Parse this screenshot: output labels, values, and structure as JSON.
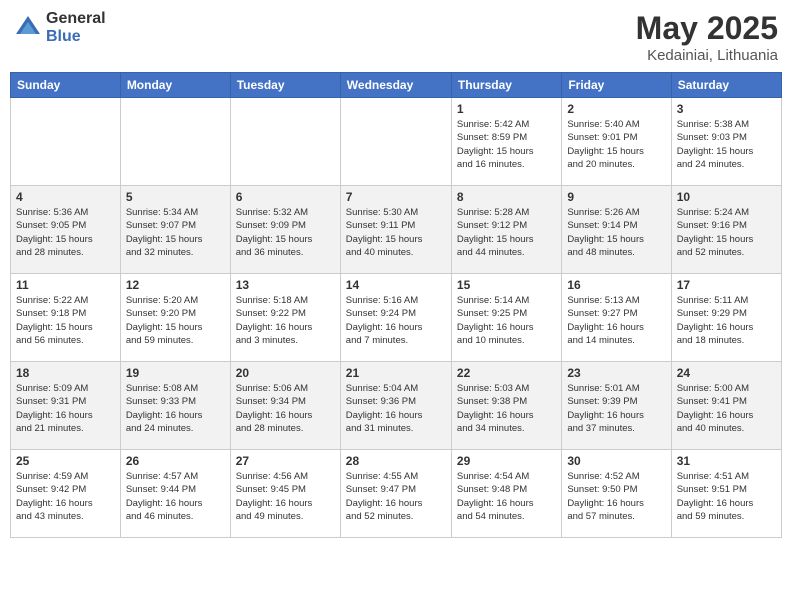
{
  "header": {
    "logo_general": "General",
    "logo_blue": "Blue",
    "month_year": "May 2025",
    "location": "Kedainiai, Lithuania"
  },
  "weekdays": [
    "Sunday",
    "Monday",
    "Tuesday",
    "Wednesday",
    "Thursday",
    "Friday",
    "Saturday"
  ],
  "weeks": [
    [
      {
        "day": "",
        "info": ""
      },
      {
        "day": "",
        "info": ""
      },
      {
        "day": "",
        "info": ""
      },
      {
        "day": "",
        "info": ""
      },
      {
        "day": "1",
        "info": "Sunrise: 5:42 AM\nSunset: 8:59 PM\nDaylight: 15 hours\nand 16 minutes."
      },
      {
        "day": "2",
        "info": "Sunrise: 5:40 AM\nSunset: 9:01 PM\nDaylight: 15 hours\nand 20 minutes."
      },
      {
        "day": "3",
        "info": "Sunrise: 5:38 AM\nSunset: 9:03 PM\nDaylight: 15 hours\nand 24 minutes."
      }
    ],
    [
      {
        "day": "4",
        "info": "Sunrise: 5:36 AM\nSunset: 9:05 PM\nDaylight: 15 hours\nand 28 minutes."
      },
      {
        "day": "5",
        "info": "Sunrise: 5:34 AM\nSunset: 9:07 PM\nDaylight: 15 hours\nand 32 minutes."
      },
      {
        "day": "6",
        "info": "Sunrise: 5:32 AM\nSunset: 9:09 PM\nDaylight: 15 hours\nand 36 minutes."
      },
      {
        "day": "7",
        "info": "Sunrise: 5:30 AM\nSunset: 9:11 PM\nDaylight: 15 hours\nand 40 minutes."
      },
      {
        "day": "8",
        "info": "Sunrise: 5:28 AM\nSunset: 9:12 PM\nDaylight: 15 hours\nand 44 minutes."
      },
      {
        "day": "9",
        "info": "Sunrise: 5:26 AM\nSunset: 9:14 PM\nDaylight: 15 hours\nand 48 minutes."
      },
      {
        "day": "10",
        "info": "Sunrise: 5:24 AM\nSunset: 9:16 PM\nDaylight: 15 hours\nand 52 minutes."
      }
    ],
    [
      {
        "day": "11",
        "info": "Sunrise: 5:22 AM\nSunset: 9:18 PM\nDaylight: 15 hours\nand 56 minutes."
      },
      {
        "day": "12",
        "info": "Sunrise: 5:20 AM\nSunset: 9:20 PM\nDaylight: 15 hours\nand 59 minutes."
      },
      {
        "day": "13",
        "info": "Sunrise: 5:18 AM\nSunset: 9:22 PM\nDaylight: 16 hours\nand 3 minutes."
      },
      {
        "day": "14",
        "info": "Sunrise: 5:16 AM\nSunset: 9:24 PM\nDaylight: 16 hours\nand 7 minutes."
      },
      {
        "day": "15",
        "info": "Sunrise: 5:14 AM\nSunset: 9:25 PM\nDaylight: 16 hours\nand 10 minutes."
      },
      {
        "day": "16",
        "info": "Sunrise: 5:13 AM\nSunset: 9:27 PM\nDaylight: 16 hours\nand 14 minutes."
      },
      {
        "day": "17",
        "info": "Sunrise: 5:11 AM\nSunset: 9:29 PM\nDaylight: 16 hours\nand 18 minutes."
      }
    ],
    [
      {
        "day": "18",
        "info": "Sunrise: 5:09 AM\nSunset: 9:31 PM\nDaylight: 16 hours\nand 21 minutes."
      },
      {
        "day": "19",
        "info": "Sunrise: 5:08 AM\nSunset: 9:33 PM\nDaylight: 16 hours\nand 24 minutes."
      },
      {
        "day": "20",
        "info": "Sunrise: 5:06 AM\nSunset: 9:34 PM\nDaylight: 16 hours\nand 28 minutes."
      },
      {
        "day": "21",
        "info": "Sunrise: 5:04 AM\nSunset: 9:36 PM\nDaylight: 16 hours\nand 31 minutes."
      },
      {
        "day": "22",
        "info": "Sunrise: 5:03 AM\nSunset: 9:38 PM\nDaylight: 16 hours\nand 34 minutes."
      },
      {
        "day": "23",
        "info": "Sunrise: 5:01 AM\nSunset: 9:39 PM\nDaylight: 16 hours\nand 37 minutes."
      },
      {
        "day": "24",
        "info": "Sunrise: 5:00 AM\nSunset: 9:41 PM\nDaylight: 16 hours\nand 40 minutes."
      }
    ],
    [
      {
        "day": "25",
        "info": "Sunrise: 4:59 AM\nSunset: 9:42 PM\nDaylight: 16 hours\nand 43 minutes."
      },
      {
        "day": "26",
        "info": "Sunrise: 4:57 AM\nSunset: 9:44 PM\nDaylight: 16 hours\nand 46 minutes."
      },
      {
        "day": "27",
        "info": "Sunrise: 4:56 AM\nSunset: 9:45 PM\nDaylight: 16 hours\nand 49 minutes."
      },
      {
        "day": "28",
        "info": "Sunrise: 4:55 AM\nSunset: 9:47 PM\nDaylight: 16 hours\nand 52 minutes."
      },
      {
        "day": "29",
        "info": "Sunrise: 4:54 AM\nSunset: 9:48 PM\nDaylight: 16 hours\nand 54 minutes."
      },
      {
        "day": "30",
        "info": "Sunrise: 4:52 AM\nSunset: 9:50 PM\nDaylight: 16 hours\nand 57 minutes."
      },
      {
        "day": "31",
        "info": "Sunrise: 4:51 AM\nSunset: 9:51 PM\nDaylight: 16 hours\nand 59 minutes."
      }
    ]
  ]
}
